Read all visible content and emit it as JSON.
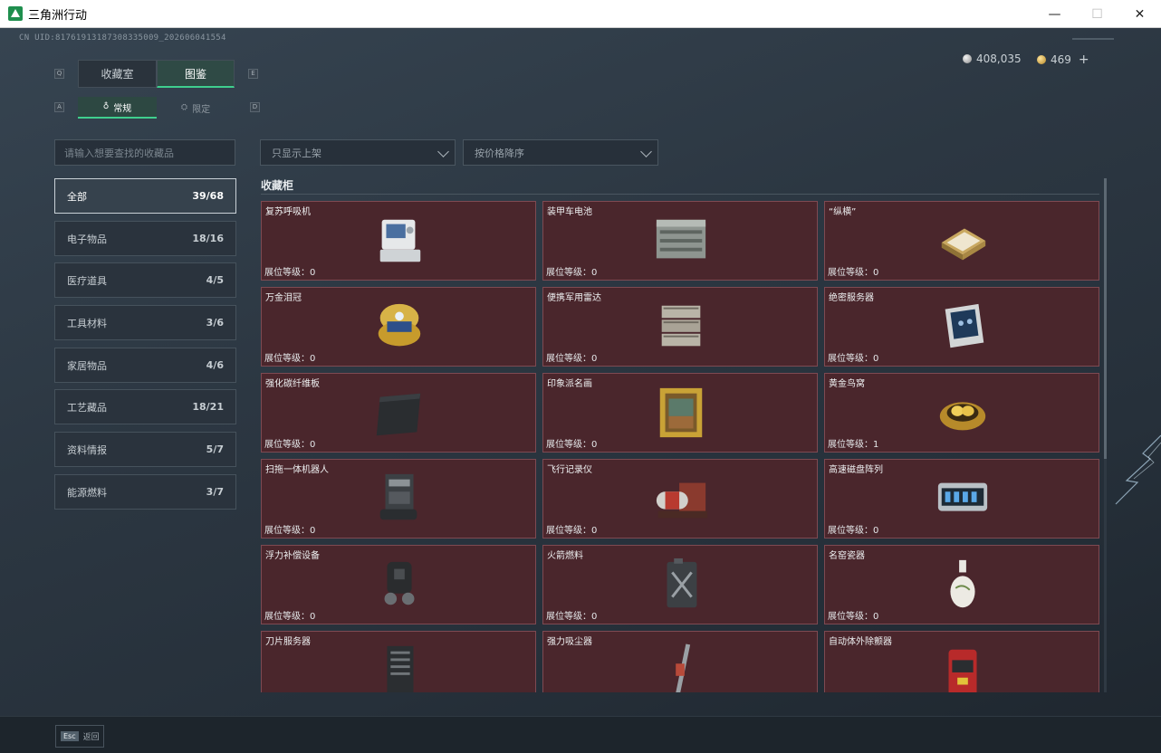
{
  "window": {
    "title": "三角洲行动",
    "min_glyph": "—",
    "max_glyph": "☐",
    "close_glyph": "✕"
  },
  "header": {
    "uid": "CN UID:81761913187308335009_202606041554",
    "currency_silver": "408,035",
    "currency_gold": "469",
    "plus": "+"
  },
  "tabs": {
    "left_key": "Q",
    "right_key": "E",
    "items": [
      {
        "label": "收藏室"
      },
      {
        "label": "图鉴"
      }
    ],
    "sub_left_key": "A",
    "sub_right_key": "D",
    "sub_items": [
      {
        "label": "常规",
        "icon": "flame-icon"
      },
      {
        "label": "限定",
        "icon": "limited-icon"
      }
    ]
  },
  "search": {
    "placeholder": "请输入想要查找的收藏品"
  },
  "filters": {
    "display": "只显示上架",
    "sort": "按价格降序"
  },
  "categories": [
    {
      "label": "全部",
      "count": "39/68"
    },
    {
      "label": "电子物品",
      "count": "18/16"
    },
    {
      "label": "医疗道具",
      "count": "4/5"
    },
    {
      "label": "工具材料",
      "count": "3/6"
    },
    {
      "label": "家居物品",
      "count": "4/6"
    },
    {
      "label": "工艺藏品",
      "count": "18/21"
    },
    {
      "label": "资料情报",
      "count": "5/7"
    },
    {
      "label": "能源燃料",
      "count": "3/7"
    }
  ],
  "cabinet": {
    "title": "收藏柜",
    "level_label": "展位等级：",
    "items": [
      {
        "name": "复苏呼吸机",
        "level": "0",
        "icon": "ventilator-icon"
      },
      {
        "name": "装甲车电池",
        "level": "0",
        "icon": "battery-icon"
      },
      {
        "name": "“纵横”",
        "level": "0",
        "icon": "chessboard-icon"
      },
      {
        "name": "万金泪冠",
        "level": "0",
        "icon": "jeweled-egg-icon"
      },
      {
        "name": "便携军用雷达",
        "level": "0",
        "icon": "radar-icon"
      },
      {
        "name": "绝密服务器",
        "level": "0",
        "icon": "server-board-icon"
      },
      {
        "name": "强化碳纤维板",
        "level": "0",
        "icon": "carbon-plate-icon"
      },
      {
        "name": "印象派名画",
        "level": "0",
        "icon": "painting-icon"
      },
      {
        "name": "黄金鸟窝",
        "level": "1",
        "icon": "golden-nest-icon"
      },
      {
        "name": "扫拖一体机器人",
        "level": "0",
        "icon": "robot-vacuum-icon"
      },
      {
        "name": "飞行记录仪",
        "level": "0",
        "icon": "flight-recorder-icon"
      },
      {
        "name": "高速磁盘阵列",
        "level": "0",
        "icon": "disk-array-icon"
      },
      {
        "name": "浮力补偿设备",
        "level": "0",
        "icon": "buoyancy-device-icon"
      },
      {
        "name": "火箭燃料",
        "level": "0",
        "icon": "fuel-can-icon"
      },
      {
        "name": "名窑瓷器",
        "level": "0",
        "icon": "vase-icon"
      },
      {
        "name": "刀片服务器",
        "level": "",
        "icon": "blade-server-icon"
      },
      {
        "name": "强力吸尘器",
        "level": "",
        "icon": "vacuum-cleaner-icon"
      },
      {
        "name": "自动体外除颤器",
        "level": "",
        "icon": "defibrillator-icon"
      }
    ]
  },
  "footer": {
    "esc_key": "Esc",
    "esc_label": "返回"
  }
}
